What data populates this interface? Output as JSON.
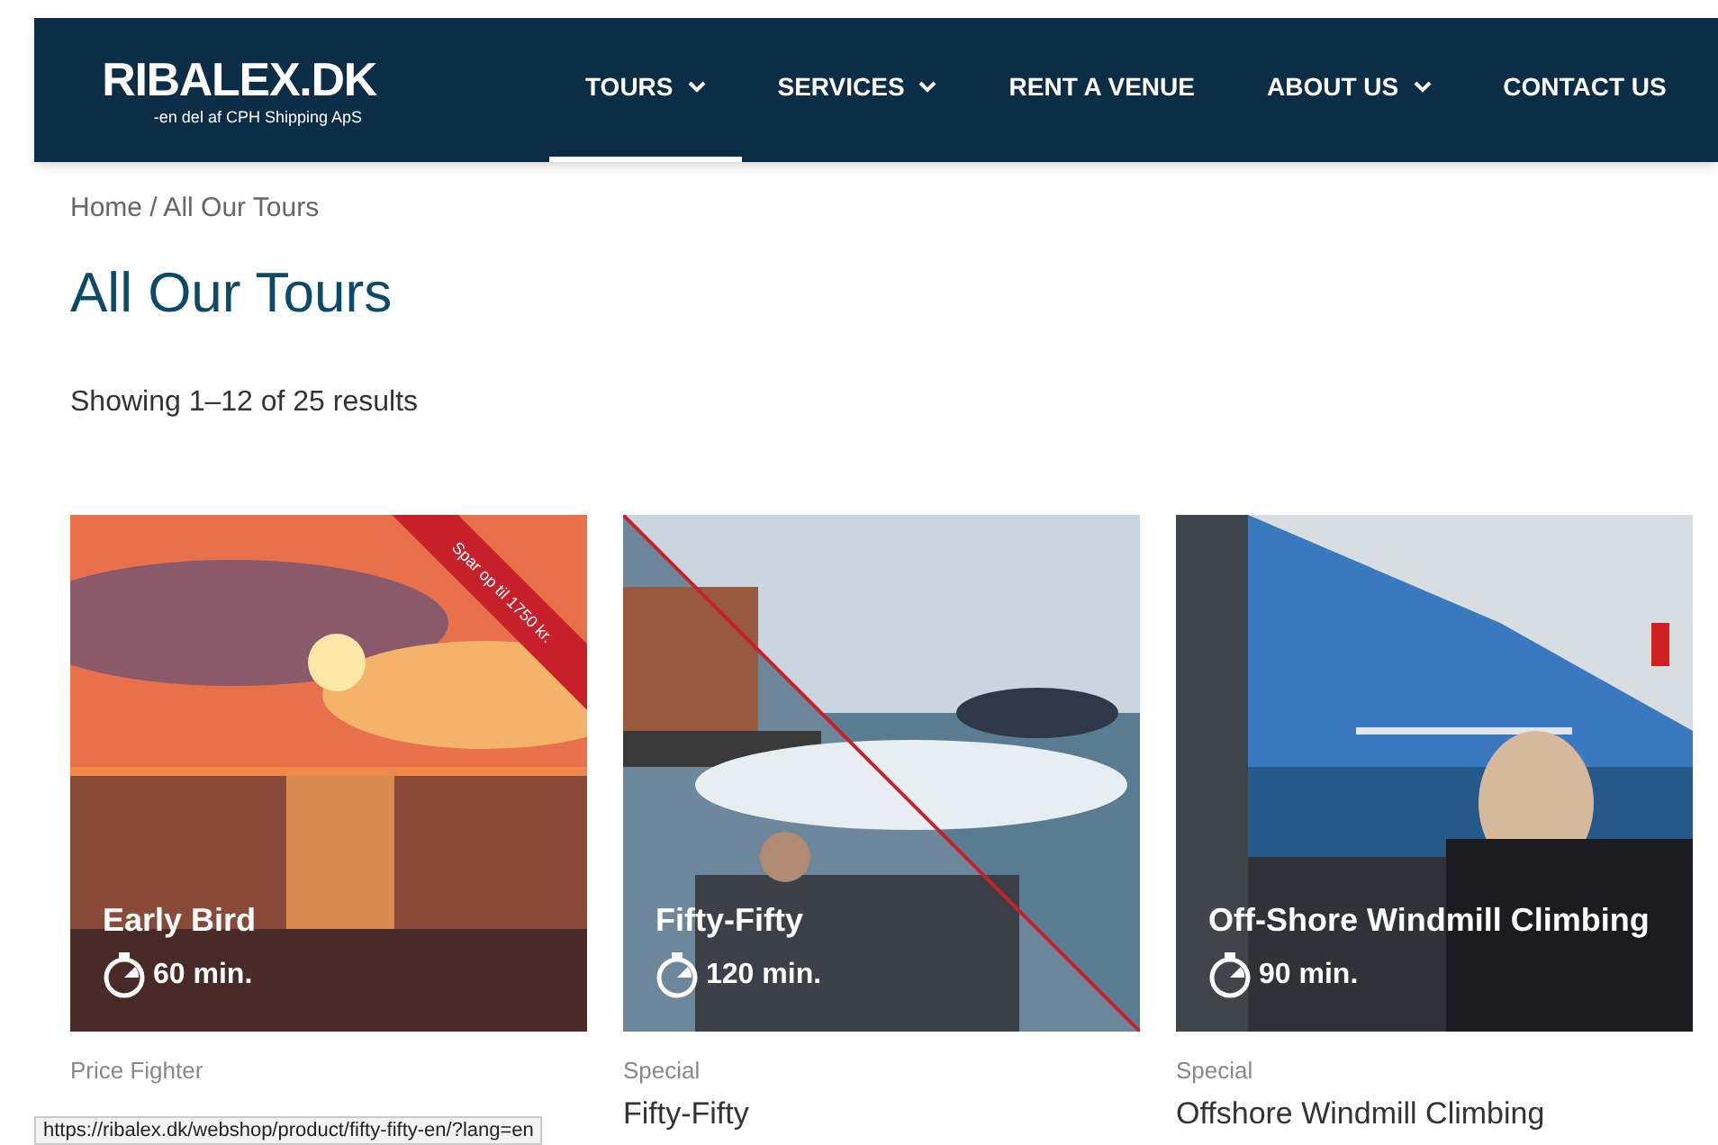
{
  "header": {
    "logo": "RIBALEX.DK",
    "logo_tagline": "-en del af CPH Shipping ApS",
    "nav": [
      {
        "label": "TOURS",
        "dropdown": true,
        "selected": true
      },
      {
        "label": "SERVICES",
        "dropdown": true,
        "selected": false
      },
      {
        "label": "RENT A VENUE",
        "dropdown": false,
        "selected": false
      },
      {
        "label": "ABOUT US",
        "dropdown": true,
        "selected": false
      },
      {
        "label": "CONTACT US",
        "dropdown": false,
        "selected": false
      }
    ]
  },
  "breadcrumb": "Home / All Our Tours",
  "heading": "All Our Tours",
  "result_count": "Showing 1–12 of 25 results",
  "products": [
    {
      "category": "Price Fighter",
      "overlay_title": "Early Bird",
      "duration": "60 min.",
      "ribbon": "Spar op til 1750 kr."
    },
    {
      "category": "Special",
      "title": "Fifty-Fifty",
      "overlay_title": "Fifty-Fifty",
      "duration": "120 min."
    },
    {
      "category": "Special",
      "title": "Offshore Windmill Climbing",
      "overlay_title": "Off-Shore Windmill Climbing",
      "duration": "90 min."
    }
  ],
  "status_url": "https://ribalex.dk/webshop/product/fifty-fifty-en/?lang=en"
}
